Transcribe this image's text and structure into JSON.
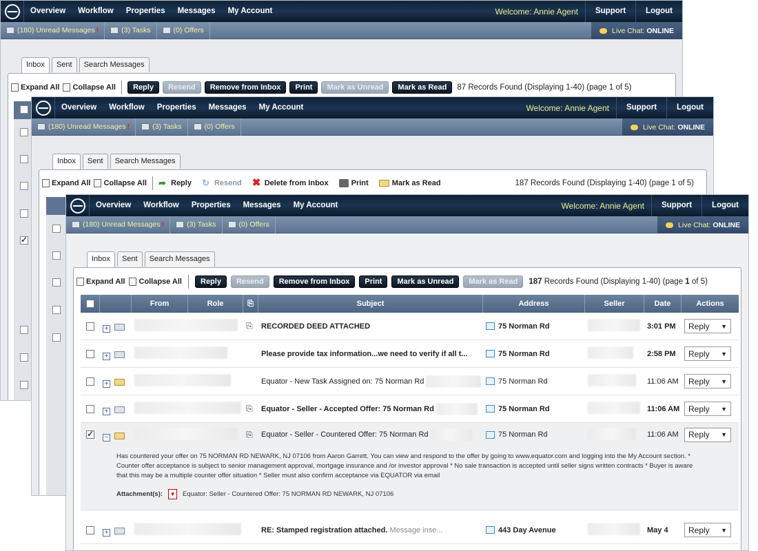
{
  "nav": {
    "items": [
      "Overview",
      "Workflow",
      "Properties",
      "Messages",
      "My Account"
    ],
    "welcome": "Welcome: Annie Agent",
    "support": "Support",
    "logout": "Logout"
  },
  "subbar": {
    "unread": "(180) Unread Messages",
    "unread_mark": "!",
    "tasks": "(3) Tasks",
    "offers": "(0) Offers",
    "chat_label": "Live Chat:",
    "chat_status": "ONLINE"
  },
  "tabs": [
    "Inbox",
    "Sent",
    "Search Messages"
  ],
  "toolbar": {
    "expand_all": "Expand All",
    "collapse_all": "Collapse All",
    "reply": "Reply",
    "resend": "Resend",
    "remove": "Remove from Inbox",
    "delete": "Delete from Inbox",
    "print": "Print",
    "mark_unread": "Mark as Unread",
    "mark_read": "Mark as Read"
  },
  "records": {
    "back": "87 Records Found (Displaying 1-40) (page 1 of 5)",
    "middle": "187 Records Found (Displaying 1-40) (page 1 of 5)",
    "front_count": "187",
    "front_mid": "Records Found (Displaying 1-40) (page",
    "front_page": "1",
    "front_end": "of 5)"
  },
  "columns": [
    "From",
    "Role",
    "Subject",
    "Address",
    "Seller",
    "Date",
    "Actions"
  ],
  "rows": [
    {
      "subject": "RECORDED DEED ATTACHED",
      "address": "75 Norman Rd",
      "date": "3:01 PM",
      "action": "Reply"
    },
    {
      "subject": "Please provide tax information...we need to verify if all t...",
      "address": "75 Norman Rd",
      "date": "2:58 PM",
      "action": "Reply"
    },
    {
      "subject": "Equator - New Task Assigned on: 75 Norman Rd",
      "address": "75 Norman Rd",
      "date": "11:06 AM",
      "action": "Reply"
    },
    {
      "subject": "Equator - Seller - Accepted Offer: 75 Norman Rd",
      "address": "75 Norman Rd",
      "date": "11:06 AM",
      "action": "Reply"
    },
    {
      "subject": "Equator - Seller - Countered Offer: 75 Norman Rd",
      "address": "75 Norman Rd",
      "date": "11:06 AM",
      "action": "Reply"
    },
    {
      "subject": "RE: Stamped registration attached.",
      "preview": "Message inse...",
      "address": "443 Day Avenue",
      "date": "May 4",
      "action": "Reply"
    }
  ],
  "expanded": {
    "body": "Has countered your offer on 75 NORMAN RD NEWARK, NJ 07106 from Aaron Garrett. You can view and respond to the offer by going to www.equator.com and logging into the My Account section. * Counter offer acceptance is subject to senior management approval, mortgage insurance and /or investor approval * No sale transaction is accepted until seller signs written contracts * Buyer is aware that this may be a multiple counter offer situation * Seller must also confirm acceptance via EQUATOR via email",
    "attach_label": "Attachment(s):",
    "attach_name": "Equator: Seller - Countered Offer: 75 NORMAN RD NEWARK, NJ 07106"
  }
}
